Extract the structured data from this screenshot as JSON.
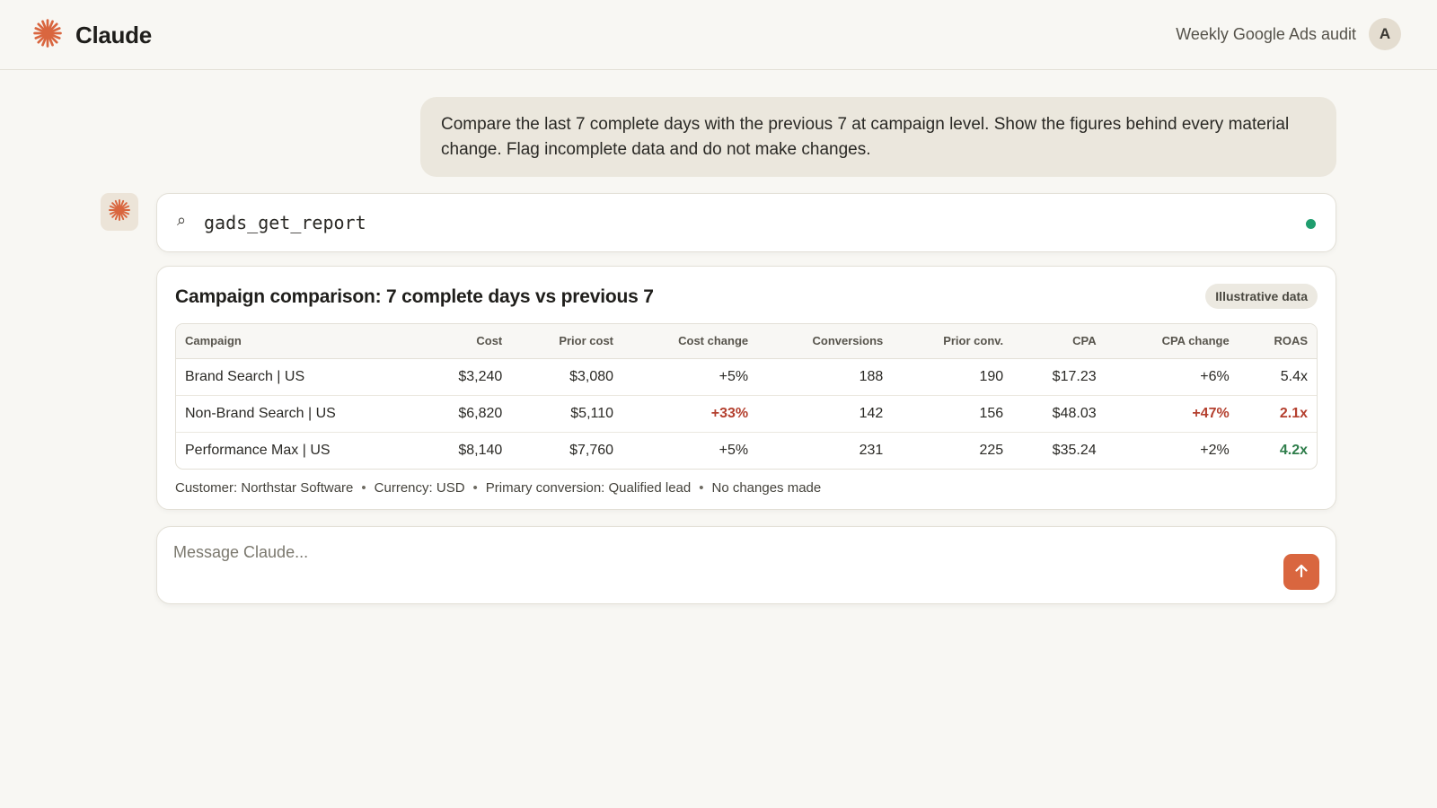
{
  "app": {
    "name": "Claude",
    "conversation_title": "Weekly Google Ads audit",
    "user_initial": "A",
    "accent_color": "#d9663f"
  },
  "user_message": "Compare the last 7 complete days with the previous 7 at campaign level. Show the figures behind every material change. Flag incomplete data and do not make changes.",
  "tool_call": {
    "icon": "search-icon",
    "name": "gads_get_report",
    "status_color": "#1f9d6e"
  },
  "report": {
    "title": "Campaign comparison: 7 complete days vs previous 7",
    "badge": "Illustrative data",
    "columns": [
      "Campaign",
      "Cost",
      "Prior cost",
      "Cost change",
      "Conversions",
      "Prior conv.",
      "CPA",
      "CPA change",
      "ROAS"
    ],
    "rows": [
      {
        "campaign": "Brand Search | US",
        "cost": "$3,240",
        "prior_cost": "$3,080",
        "cost_change": "+5%",
        "conversions": "188",
        "prior_conv": "190",
        "cpa": "$17.23",
        "cpa_change": "+6%",
        "roas": "5.4x"
      },
      {
        "campaign": "Non-Brand Search | US",
        "cost": "$6,820",
        "prior_cost": "$5,110",
        "cost_change": "+33%",
        "conversions": "142",
        "prior_conv": "156",
        "cpa": "$48.03",
        "cpa_change": "+47%",
        "roas": "2.1x"
      },
      {
        "campaign": "Performance Max | US",
        "cost": "$8,140",
        "prior_cost": "$7,760",
        "cost_change": "+5%",
        "conversions": "231",
        "prior_conv": "225",
        "cpa": "$35.24",
        "cpa_change": "+2%",
        "roas": "4.2x"
      }
    ],
    "meta": {
      "customer": "Customer: Northstar Software",
      "currency": "Currency: USD",
      "conversion": "Primary conversion: Qualified lead",
      "changes": "No changes made",
      "separator": "•"
    }
  },
  "composer": {
    "placeholder": "Message Claude...",
    "send_icon": "arrow-up-icon"
  }
}
